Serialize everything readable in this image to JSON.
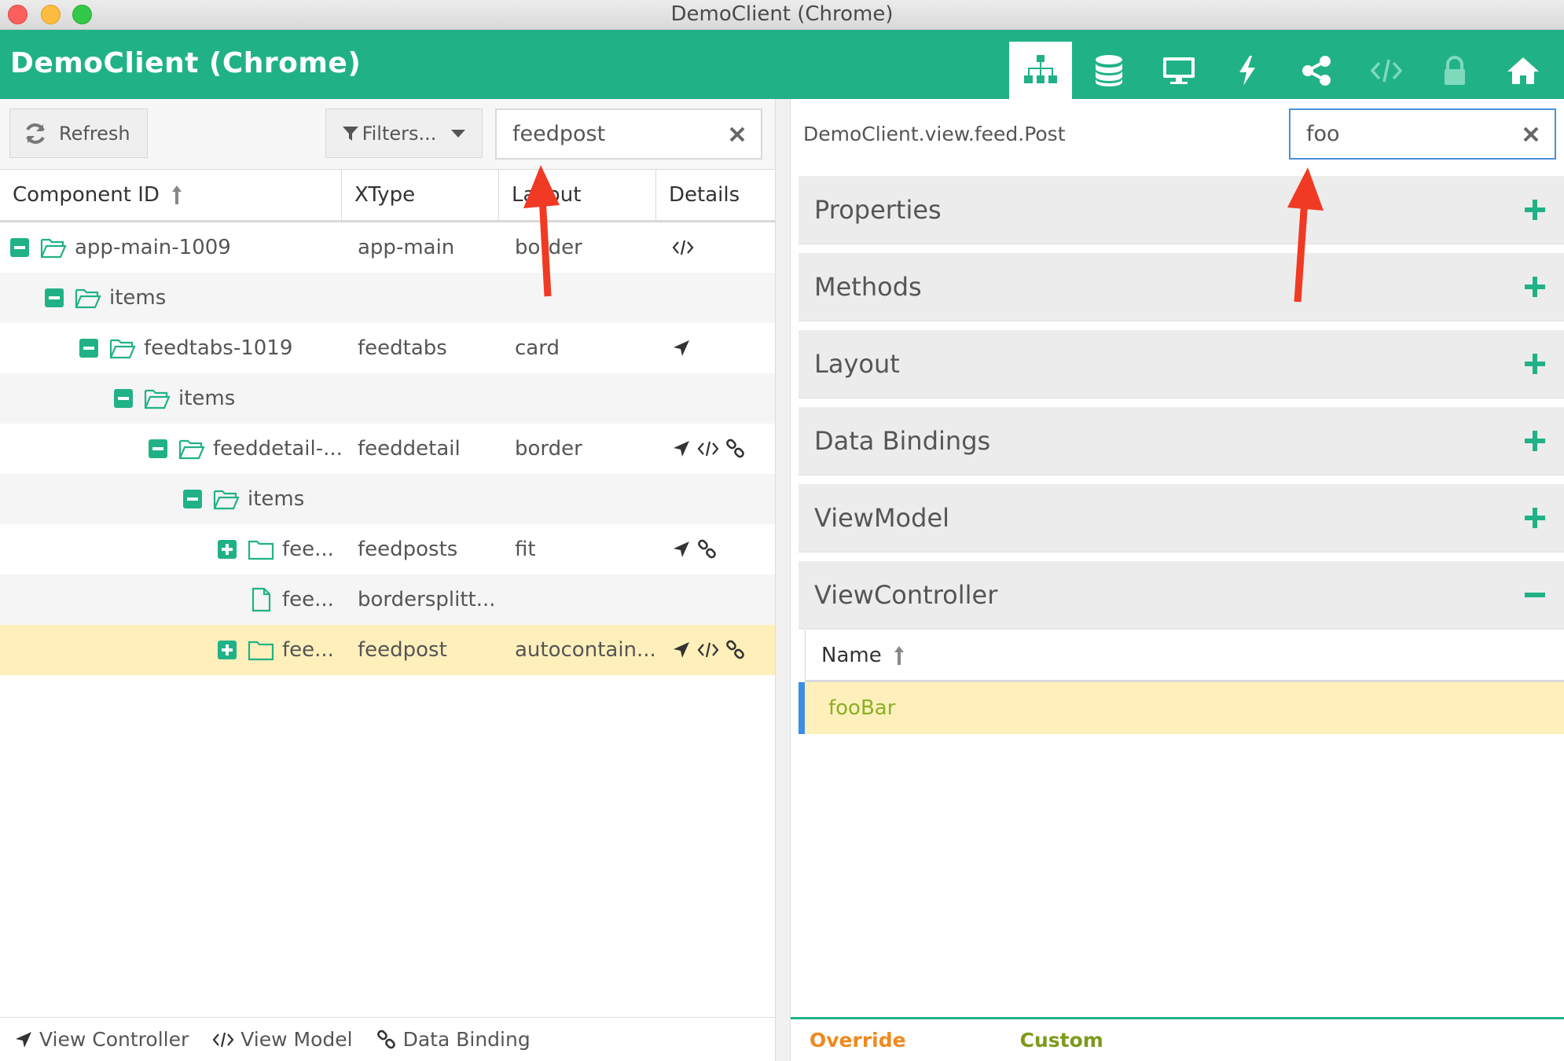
{
  "window": {
    "title": "DemoClient (Chrome)"
  },
  "app": {
    "title": "DemoClient (Chrome)",
    "nav": [
      "components-icon",
      "stores-icon",
      "desktop-icon",
      "events-icon",
      "share-icon",
      "code-icon",
      "lock-icon",
      "home-icon"
    ]
  },
  "left": {
    "refresh_label": "Refresh",
    "filters_label": "Filters...",
    "search_value": "feedpost",
    "columns": [
      "Component ID",
      "XType",
      "Layout",
      "Details"
    ],
    "rows": [
      {
        "id": "app-main-1009",
        "xtype": "app-main",
        "layout": "border"
      },
      {
        "id": "items",
        "xtype": "",
        "layout": ""
      },
      {
        "id": "feedtabs-1019",
        "xtype": "feedtabs",
        "layout": "card"
      },
      {
        "id": "items",
        "xtype": "",
        "layout": ""
      },
      {
        "id": "feeddetail-...",
        "xtype": "feeddetail",
        "layout": "border"
      },
      {
        "id": "items",
        "xtype": "",
        "layout": ""
      },
      {
        "id": "fee...",
        "xtype": "feedposts",
        "layout": "fit"
      },
      {
        "id": "fee...",
        "xtype": "bordersplitt...",
        "layout": ""
      },
      {
        "id": "fee...",
        "xtype": "feedpost",
        "layout": "autocontain..."
      }
    ],
    "footer": [
      "View Controller",
      "View Model",
      "Data Binding"
    ]
  },
  "right": {
    "class_name": "DemoClient.view.feed.Post",
    "search_value": "foo",
    "panels": [
      "Properties",
      "Methods",
      "Layout",
      "Data Bindings",
      "ViewModel",
      "ViewController"
    ],
    "vc_column": "Name",
    "vc_value": "fooBar",
    "footer_override": "Override",
    "footer_custom": "Custom"
  },
  "colors": {
    "accent": "#20b286",
    "selected_row": "#ffefbb",
    "override": "#f0891e",
    "custom": "#7c9a1c",
    "arrow": "#f03a24"
  }
}
